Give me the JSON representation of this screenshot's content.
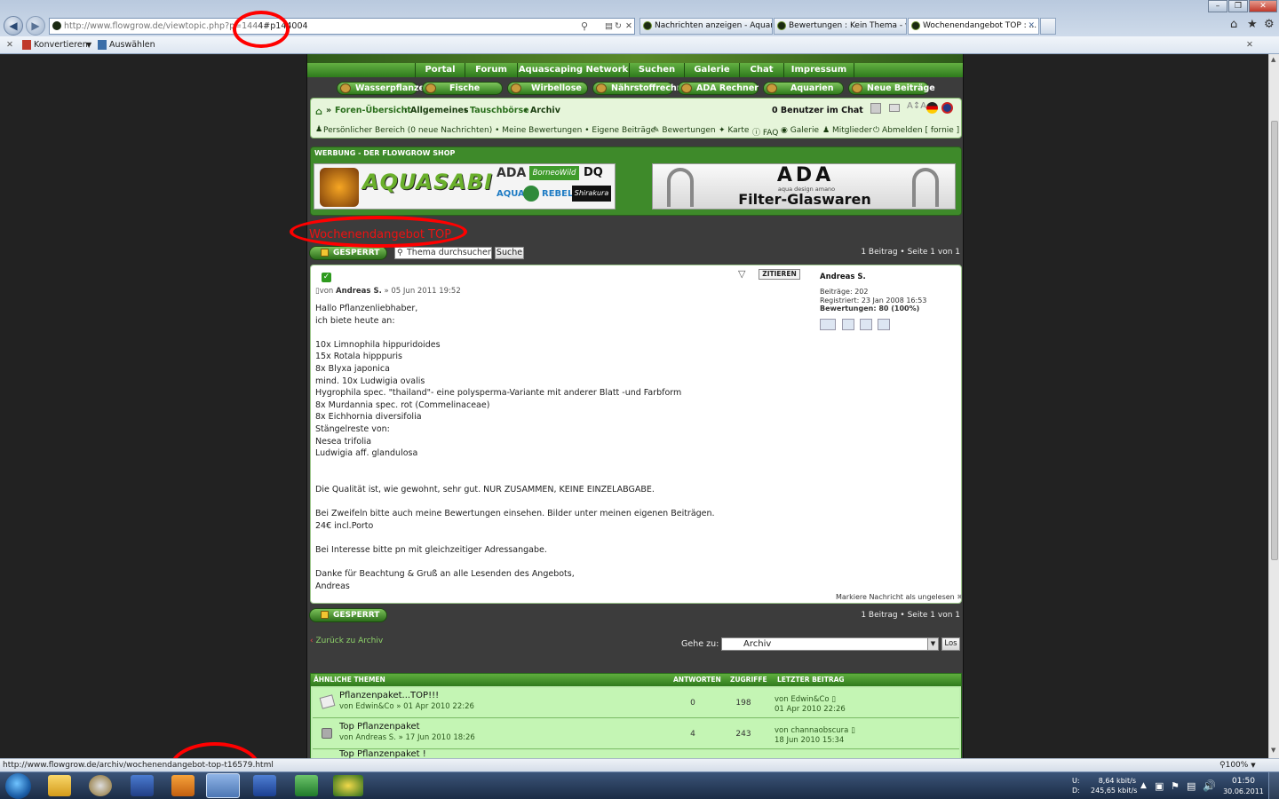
{
  "browser": {
    "url_prefix": "http://www.flowgrow.de/",
    "url_main": "viewtopic.php?p=144",
    "url_anchor": "4#p144004",
    "tabs": [
      {
        "label": "Nachrichten anzeigen - Aquari..."
      },
      {
        "label": "Bewertungen : Kein Thema - w..."
      },
      {
        "label": "Wochenendangebot TOP : ..."
      }
    ],
    "cmd_convert": "Konvertieren",
    "cmd_select": "Auswählen"
  },
  "forum": {
    "topmenu": [
      "Portal",
      "Forum",
      "Aquascaping Network",
      "Suchen",
      "Galerie",
      "Chat",
      "Impressum"
    ],
    "categories": [
      "Wasserpflanzen",
      "Fische",
      "Wirbellose",
      "Nährstoffrechner",
      "ADA Rechner",
      "Aquarien",
      "Neue Beiträge"
    ],
    "breadcrumb": {
      "sep": "»",
      "home": "Foren-Übersicht",
      "c1": "Allgemeines",
      "c2": "Tauschbörse",
      "c3": "Archiv",
      "chat": "0 Benutzer im Chat"
    },
    "personal": "Persönlicher Bereich (0 neue Nachrichten) • Meine Bewertungen • Eigene Beiträge",
    "links": [
      "Bewertungen",
      "Karte",
      "FAQ",
      "Galerie",
      "Mitglieder",
      "Abmelden [ fornie ]"
    ],
    "ad_title": "WERBUNG - DER FLOWGROW SHOP",
    "ad1": {
      "main": "AQUASABI",
      "ada": "ADA",
      "borneo": "BorneoWild",
      "dq": "DQ",
      "aqua": "AQUA",
      "rebell": "REBELL",
      "shira": "Shirakura"
    },
    "ad2": {
      "brand": "ADA",
      "sub": "aqua design amano",
      "text": "Filter-Glaswaren"
    },
    "topic_title": "Wochenendangebot TOP",
    "locked_label": "GESPERRT",
    "search_placeholder": "Thema durchsuchen...",
    "search_button": "Suche",
    "page_info": "1 Beitrag • Seite 1 von 1",
    "post": {
      "quote_label": "ZITIEREN",
      "meta_prefix": "von",
      "author": "Andreas S.",
      "date": "» 05 Jun 2011 19:52",
      "lines": [
        "Hallo Pflanzenliebhaber,",
        "ich biete heute an:",
        "",
        "10x Limnophila hippuridoides",
        "15x Rotala hipppuris",
        "8x Blyxa japonica",
        "mind. 10x Ludwigia ovalis",
        "Hygrophila spec. \"thailand\"- eine polysperma-Variante mit anderer Blatt -und Farbform",
        "8x Murdannia spec. rot (Commelinaceae)",
        "8x Eichhornia diversifolia",
        "Stängelreste von:",
        "Nesea trifolia",
        "Ludwigia aff. glandulosa",
        "",
        "",
        "Die Qualität ist, wie gewohnt, sehr gut. NUR ZUSAMMEN, KEINE EINZELABGABE.",
        "",
        "Bei Zweifeln bitte auch meine Bewertungen einsehen. Bilder unter meinen eigenen Beiträgen.",
        "24€ incl.Porto",
        "",
        "Bei Interesse bitte pn mit gleichzeitiger Adressangabe.",
        "",
        "Danke für Beachtung & Gruß an alle Lesenden des Angebots,",
        "Andreas"
      ],
      "profile": {
        "name": "Andreas S.",
        "posts": "Beiträge: 202",
        "registered": "Registriert: 23 Jan 2008 16:53",
        "ratings": "Bewertungen: 80 (100%)"
      },
      "mark_unread": "Markiere Nachricht als ungelesen"
    },
    "back_link": "Zurück zu Archiv",
    "goto_label": "Gehe zu:",
    "goto_value": "Archiv",
    "goto_button": "Los",
    "related": {
      "header": "ÄHNLICHE THEMEN",
      "col_answers": "ANTWORTEN",
      "col_views": "ZUGRIFFE",
      "col_last": "LETZTER BEITRAG",
      "rows": [
        {
          "title": "Pflanzenpaket...TOP!!!",
          "by": "von Edwin&Co » 01 Apr 2010 22:26",
          "answers": "0",
          "views": "198",
          "last_by": "von Edwin&Co",
          "last_date": "01 Apr 2010 22:26"
        },
        {
          "title": "Top Pflanzenpaket",
          "by": "von Andreas S. » 17 Jun 2010 18:26",
          "answers": "4",
          "views": "243",
          "last_by": "von channaobscura",
          "last_date": "18 Jun 2010 15:34"
        },
        {
          "title": "Top Pflanzenpaket !",
          "by": "",
          "answers": "",
          "views": "",
          "last_by": "",
          "last_date": ""
        }
      ]
    }
  },
  "status": {
    "url": "http://www.flowgrow.de/archiv/wochenendangebot-top-t16579.html",
    "zoom": "100%"
  },
  "taskbar": {
    "net_up_label": "U:",
    "net_down_label": "D:",
    "net_up": "8,64 kbit/s",
    "net_down": "245,65 kbit/s",
    "time": "01:50",
    "date": "30.06.2011"
  },
  "colors": {
    "accent_green": "#2f7a1c",
    "annotation_red": "#ff0000",
    "title_red": "#e11111"
  }
}
